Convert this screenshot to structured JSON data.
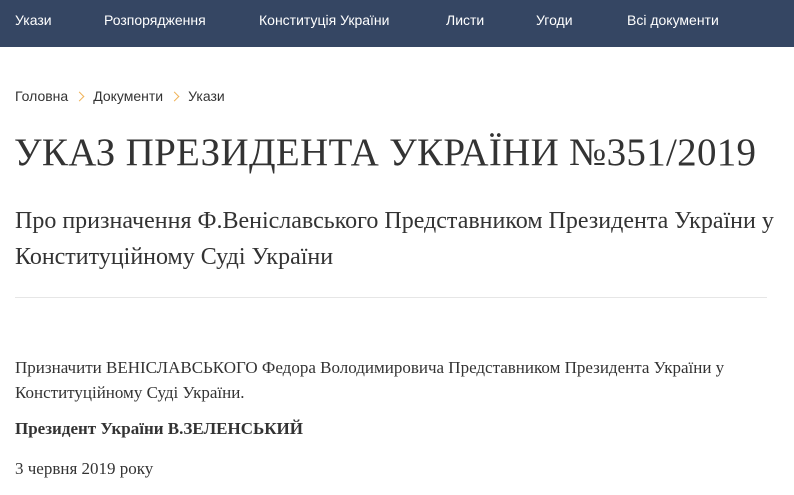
{
  "nav": {
    "items": [
      "Укази",
      "Розпорядження",
      "Конституція України",
      "Листи",
      "Угоди",
      "Всі документи"
    ]
  },
  "breadcrumb": {
    "items": [
      "Головна",
      "Документи",
      "Укази"
    ]
  },
  "document": {
    "title": "УКАЗ ПРЕЗИДЕНТА УКРАЇНИ №351/2019",
    "subtitle": "Про призначення Ф.Веніславського Представником Президента України у Конституційному Суді України",
    "body": "Призначити ВЕНІСЛАВСЬКОГО Федора Володимировича Представником Президента України у Конституційному Суді України.",
    "signature": "Президент України В.ЗЕЛЕНСЬКИЙ",
    "date": "3 червня 2019 року"
  },
  "colors": {
    "nav_background": "#354663",
    "breadcrumb_chevron": "#f0b35a"
  }
}
